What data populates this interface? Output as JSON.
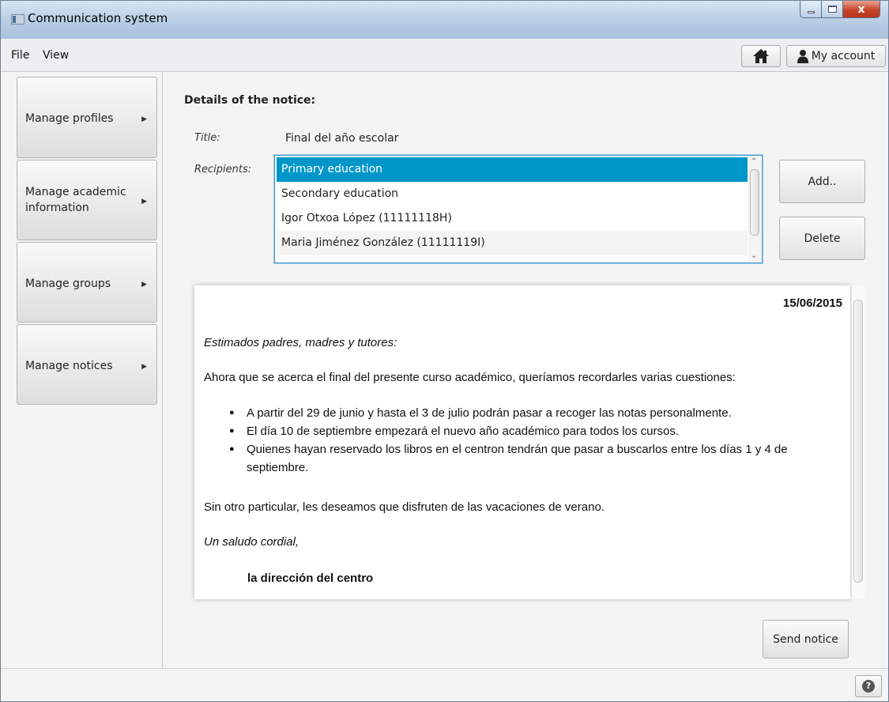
{
  "window": {
    "title": "Communication system",
    "close_glyph": "x"
  },
  "menu": {
    "items": [
      "File",
      "View"
    ],
    "my_account": "My account"
  },
  "sidebar": {
    "items": [
      {
        "label": "Manage profiles"
      },
      {
        "label": "Manage academic information"
      },
      {
        "label": "Manage groups"
      },
      {
        "label": "Manage notices"
      }
    ],
    "arrow": "▶"
  },
  "notice": {
    "heading": "Details of the notice:",
    "title_label": "Title:",
    "title_value": "Final del año escolar",
    "recipients_label": "Recipients:",
    "recipients": [
      "Primary education",
      "Secondary education",
      "Igor Otxoa López (11111118H)",
      "Maria Jiménez González (11111119I)"
    ],
    "selected_recipient_index": 0,
    "add_label": "Add..",
    "delete_label": "Delete"
  },
  "document": {
    "date": "15/06/2015",
    "greeting": "Estimados padres, madres y tutores:",
    "intro": "Ahora que se acerca el final del presente curso académico, queríamos recordarles varias cuestiones:",
    "bullets": [
      "A partir del 29 de junio y hasta el 3 de julio podrán pasar a recoger las notas personalmente.",
      "El día 10 de septiembre empezará el nuevo año académico para todos los cursos.",
      "Quienes hayan reservado los libros en el centron tendrán que pasar a buscarlos entre los días 1 y 4 de septiembre."
    ],
    "closing": "Sin otro particular, les deseamos que disfruten de las vacaciones de verano.",
    "salutation": "Un saludo cordial,",
    "signature": "la dirección del centro"
  },
  "actions": {
    "send_label": "Send notice",
    "help_glyph": "?"
  },
  "colors": {
    "selection": "#0096c9",
    "focus_border": "#3e95cf"
  },
  "icons": {
    "home": "home-icon",
    "account": "user-icon",
    "help": "help-icon"
  }
}
